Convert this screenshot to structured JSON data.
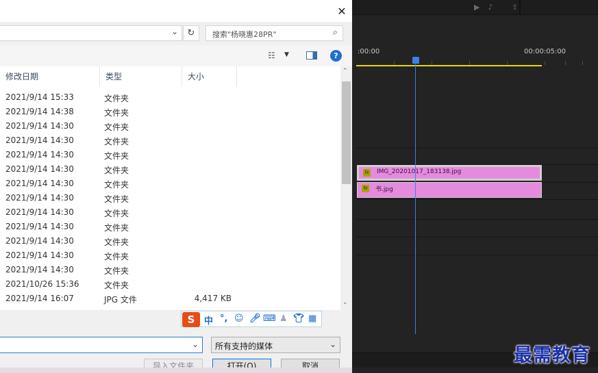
{
  "dialog": {
    "search_placeholder": "搜索\"杨晓惠28PR\"",
    "columns": {
      "date": "修改日期",
      "type": "类型",
      "size": "大小"
    },
    "rows": [
      {
        "date": "2021/9/14 15:33",
        "type": "文件夹",
        "size": ""
      },
      {
        "date": "2021/9/14 14:38",
        "type": "文件夹",
        "size": ""
      },
      {
        "date": "2021/9/14 14:30",
        "type": "文件夹",
        "size": ""
      },
      {
        "date": "2021/9/14 14:30",
        "type": "文件夹",
        "size": ""
      },
      {
        "date": "2021/9/14 14:30",
        "type": "文件夹",
        "size": ""
      },
      {
        "date": "2021/9/14 14:30",
        "type": "文件夹",
        "size": ""
      },
      {
        "date": "2021/9/14 14:30",
        "type": "文件夹",
        "size": ""
      },
      {
        "date": "2021/9/14 14:30",
        "type": "文件夹",
        "size": ""
      },
      {
        "date": "2021/9/14 14:30",
        "type": "文件夹",
        "size": ""
      },
      {
        "date": "2021/9/14 14:30",
        "type": "文件夹",
        "size": ""
      },
      {
        "date": "2021/9/14 14:30",
        "type": "文件夹",
        "size": ""
      },
      {
        "date": "2021/9/14 14:30",
        "type": "文件夹",
        "size": ""
      },
      {
        "date": "2021/9/14 14:30",
        "type": "文件夹",
        "size": ""
      },
      {
        "date": "2021/10/26 15:36",
        "type": "文件夹",
        "size": ""
      },
      {
        "date": "2021/9/14 16:07",
        "type": "JPG 文件",
        "size": "4,417 KB"
      }
    ],
    "filetype_value": "所有支持的媒体",
    "buttons": {
      "import": "导入文件夹",
      "open": "打开(O)",
      "cancel": "取消"
    },
    "ime": {
      "logo": "S",
      "mode": "中",
      "punct": "°,"
    }
  },
  "timeline": {
    "timecode_start": ":00:00",
    "timecode_end": "00:00:05:00",
    "clips": [
      {
        "name": "IMG_20201017_183138.jpg",
        "fx": "fx"
      },
      {
        "name": "书.jpg",
        "fx": "fx"
      }
    ]
  },
  "watermark": "最需教育",
  "colors": {
    "accent": "#1f6fd0",
    "clip": "#e58bde",
    "playhead": "#3a82e8",
    "workarea": "#e8d800"
  }
}
